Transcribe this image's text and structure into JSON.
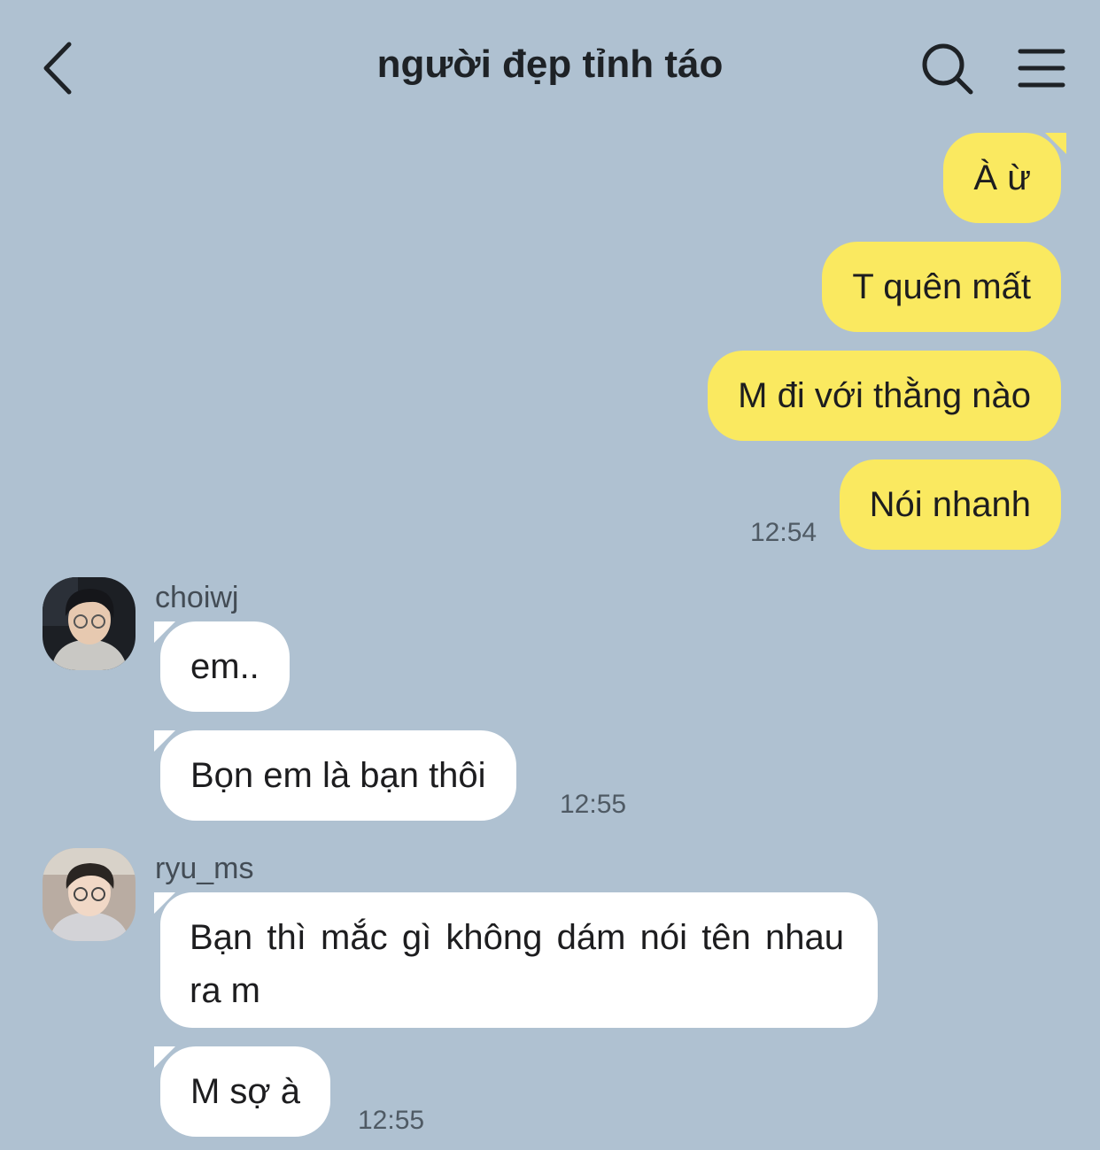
{
  "header": {
    "title": "người đẹp tỉnh táo"
  },
  "icons": {
    "back": "chevron-left-icon",
    "search": "search-icon",
    "menu": "menu-icon"
  },
  "colors": {
    "background": "#afc1d1",
    "outgoing_bubble": "#fae960",
    "incoming_bubble": "#ffffff"
  },
  "messages": {
    "out_1": "À ừ",
    "out_2": "T quên mất",
    "out_3": "M đi với thằng nào",
    "out_4": "Nói nhanh",
    "out_time": "12:54",
    "group_1": {
      "sender": "choiwj",
      "msg_1": "em..",
      "msg_2": "Bọn em là bạn thôi",
      "time": "12:55"
    },
    "group_2": {
      "sender": "ryu_ms",
      "msg_1": "Bạn thì mắc gì không dám nói tên nhau ra m",
      "msg_2": "M sợ à",
      "time": "12:55"
    }
  }
}
